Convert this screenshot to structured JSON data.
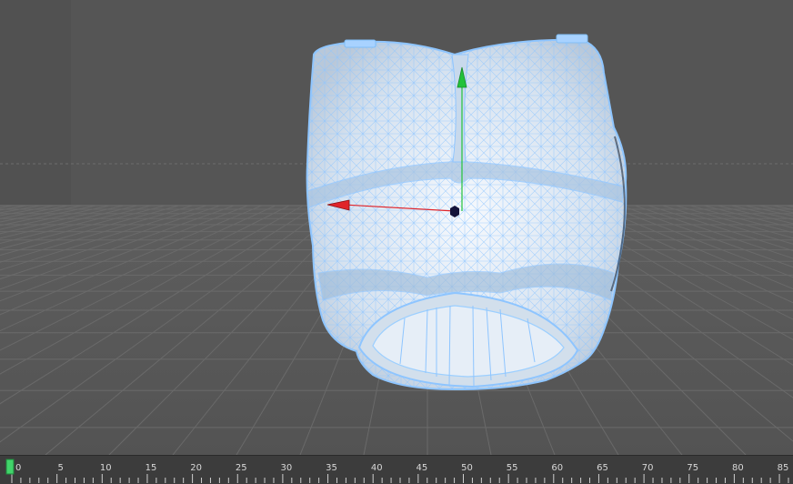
{
  "viewport": {
    "background_color": "#575757",
    "grid_color": "#6a6a6a",
    "mesh_fill_color": "#dde8f4",
    "wire_color": "#8ec5ff",
    "x_axis_color": "#e0242a",
    "y_axis_color": "#23c23a",
    "pivot_color": "#14143a"
  },
  "timeline": {
    "ticks": [
      "0",
      "5",
      "10",
      "15",
      "20",
      "25",
      "30",
      "35",
      "40",
      "45",
      "50",
      "55",
      "60",
      "65",
      "70",
      "75",
      "80",
      "85"
    ],
    "current_frame": 0,
    "playhead_color": "#41d46a"
  }
}
